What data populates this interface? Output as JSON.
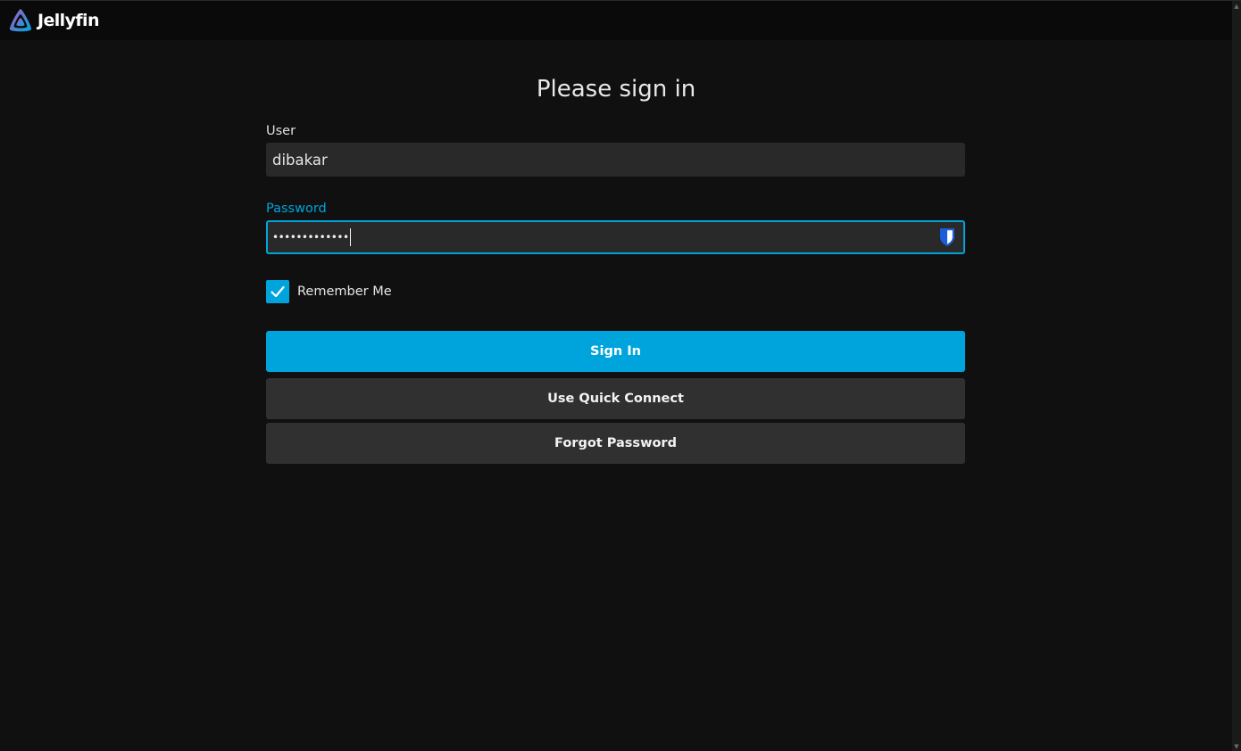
{
  "header": {
    "logo_text": "Jellyfin",
    "logo_icon": "jellyfin-logo-icon"
  },
  "main": {
    "title": "Please sign in",
    "user": {
      "label": "User",
      "value": "dibakar"
    },
    "password": {
      "label": "Password",
      "masked_value": "•••••••••••••",
      "extension_icon": "bitwarden-icon"
    },
    "remember_me": {
      "label": "Remember Me",
      "checked": true
    },
    "buttons": {
      "sign_in": "Sign In",
      "quick_connect": "Use Quick Connect",
      "forgot_password": "Forgot Password"
    }
  },
  "colors": {
    "accent": "#00a4dc",
    "background": "#101010",
    "header_background": "#0a0a0a",
    "input_background": "#292929",
    "secondary_button": "#303030"
  }
}
